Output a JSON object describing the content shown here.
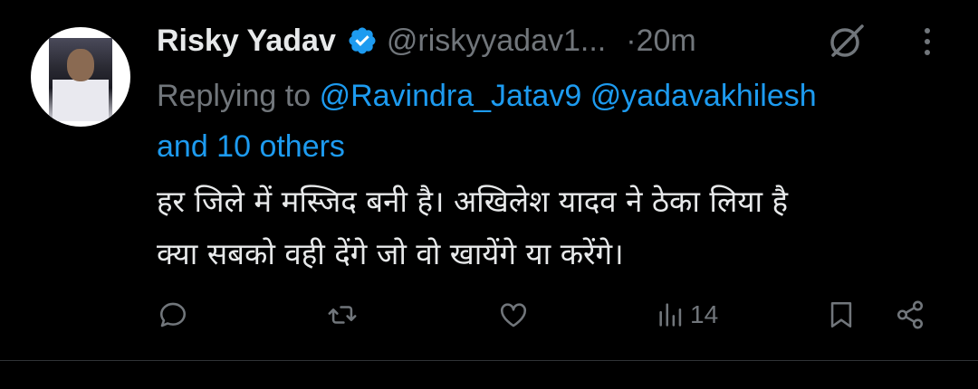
{
  "author": {
    "name": "Risky Yadav",
    "handle": "@riskyyadav1...",
    "separator": "·",
    "time": "20m"
  },
  "reply_to": {
    "prefix": "Replying to",
    "mention1": "@Ravindra_Jatav9",
    "mention2": "@yadavakhilesh",
    "others": "and 10 others"
  },
  "tweet": {
    "line1": "हर जिले में मस्जिद बनी है। अखिलेश यादव ने ठेका लिया है",
    "line2": "क्या सबको वही देंगे जो वो खायेंगे या करेंगे।"
  },
  "actions": {
    "views_count": "14"
  },
  "colors": {
    "background": "#000000",
    "text_primary": "#e7e9ea",
    "text_secondary": "#71767b",
    "accent": "#1d9bf0"
  },
  "icons": [
    "verified-badge-icon",
    "grok-icon",
    "more-options-icon",
    "reply-icon",
    "retweet-icon",
    "like-icon",
    "views-icon",
    "bookmark-icon",
    "share-icon"
  ]
}
